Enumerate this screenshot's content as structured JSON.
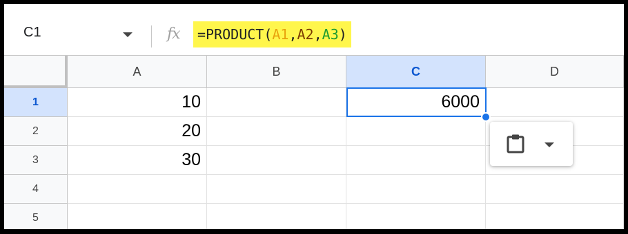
{
  "formula_bar": {
    "name_box": "C1",
    "fx_label": "fx",
    "formula_parts": {
      "prefix": "=PRODUCT(",
      "ref1": "A1",
      "sep1": ",",
      "ref2": "A2",
      "sep2": ",",
      "ref3": "A3",
      "suffix": ")"
    },
    "highlight_color": "#fff64c"
  },
  "grid": {
    "columns": [
      "A",
      "B",
      "C",
      "D"
    ],
    "rows": [
      "1",
      "2",
      "3",
      "4",
      "5"
    ],
    "active_column": "C",
    "active_row": "1",
    "cells": {
      "A1": "10",
      "A2": "20",
      "A3": "30",
      "C1": "6000"
    },
    "selected_cell": "C1",
    "selection_color": "#1a73e8"
  },
  "paste_popup": {
    "icon": "clipboard-icon",
    "menu_icon": "chevron-down-icon"
  }
}
